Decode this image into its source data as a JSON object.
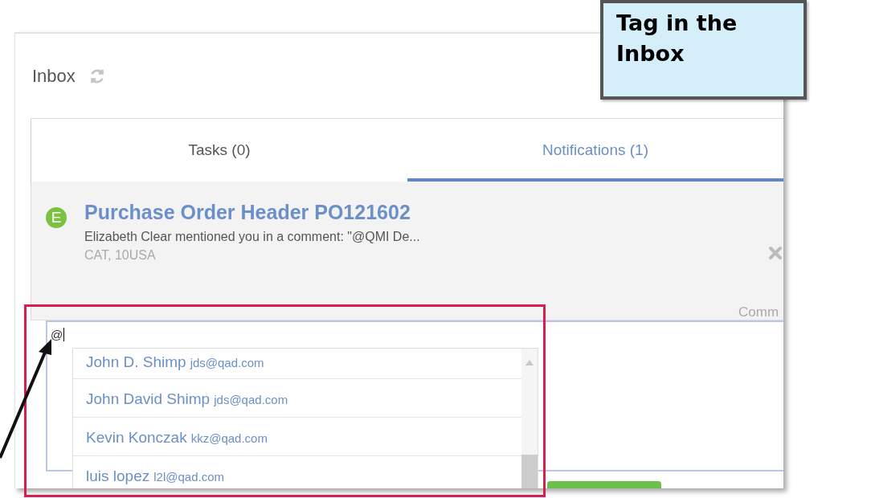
{
  "panel": {
    "title": "Inbox",
    "tabs": [
      {
        "label": "Tasks (0)",
        "selected": false
      },
      {
        "label": "Notifications (1)",
        "selected": true
      }
    ],
    "notification": {
      "avatar": "E",
      "title": "Purchase Order Header PO121602",
      "message": "Elizabeth Clear mentioned you in a comment: \"@QMI De...",
      "context": "CAT, 10USA",
      "action_label": "Comm"
    },
    "comment": {
      "value": "@",
      "suggestions": [
        {
          "name": "John D. Shimp",
          "email": "jds@qad.com"
        },
        {
          "name": "John David Shimp",
          "email": "jds@qad.com"
        },
        {
          "name": "Kevin Konczak",
          "email": "kkz@qad.com"
        },
        {
          "name": "luis lopez",
          "email": "l2l@qad.com"
        }
      ]
    }
  },
  "callout": {
    "text": "Tag in the Inbox"
  }
}
